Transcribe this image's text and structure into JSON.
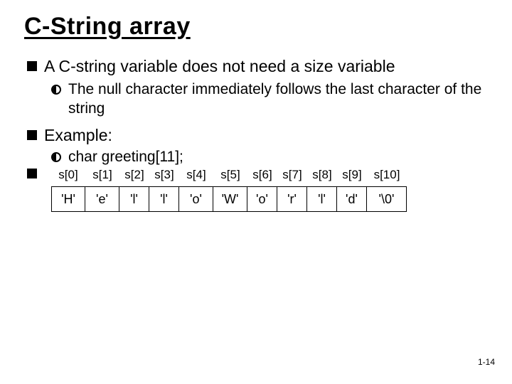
{
  "title": "C-String array",
  "bullets": {
    "b1": "A C-string variable does not need a size variable",
    "b1a": "The null character immediately follows the last character of the string",
    "b2": "Example:",
    "b2a": "char greeting[11];"
  },
  "array": {
    "headers": [
      "s[0]",
      "s[1]",
      "s[2]",
      "s[3]",
      "s[4]",
      "s[5]",
      "s[6]",
      "s[7]",
      "s[8]",
      "s[9]",
      "s[10]"
    ],
    "cells": [
      "'H'",
      "'e'",
      "'l'",
      "'l'",
      "'o'",
      "'W'",
      "'o'",
      "'r'",
      "'l'",
      "'d'",
      "'\\0'"
    ],
    "widths": [
      48,
      48,
      42,
      42,
      48,
      48,
      42,
      42,
      42,
      42,
      56
    ]
  },
  "footer": "1-14"
}
